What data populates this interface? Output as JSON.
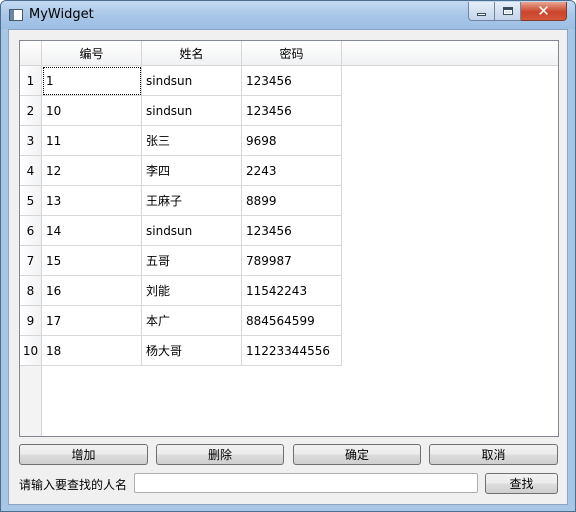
{
  "window": {
    "title": "MyWidget"
  },
  "table": {
    "columns": [
      "编号",
      "姓名",
      "密码"
    ],
    "rows": [
      {
        "header": "1",
        "cells": [
          "1",
          "sindsun",
          "123456"
        ]
      },
      {
        "header": "2",
        "cells": [
          "10",
          "sindsun",
          "123456"
        ]
      },
      {
        "header": "3",
        "cells": [
          "11",
          "张三",
          "9698"
        ]
      },
      {
        "header": "4",
        "cells": [
          "12",
          "李四",
          "2243"
        ]
      },
      {
        "header": "5",
        "cells": [
          "13",
          "王麻子",
          "8899"
        ]
      },
      {
        "header": "6",
        "cells": [
          "14",
          "sindsun",
          "123456"
        ]
      },
      {
        "header": "7",
        "cells": [
          "15",
          "五哥",
          "789987"
        ]
      },
      {
        "header": "8",
        "cells": [
          "16",
          "刘能",
          "11542243"
        ]
      },
      {
        "header": "9",
        "cells": [
          "17",
          "本广",
          "884564599"
        ]
      },
      {
        "header": "10",
        "cells": [
          "18",
          "杨大哥",
          "11223344556"
        ]
      }
    ]
  },
  "buttons": {
    "add": "增加",
    "delete": "删除",
    "confirm": "确定",
    "cancel": "取消",
    "find": "查找"
  },
  "search": {
    "label": "请输入要查找的人名",
    "value": ""
  },
  "icons": {
    "app": "window-icon",
    "minimize": "minimize-icon",
    "maximize": "maximize-icon",
    "close": "close-icon"
  }
}
